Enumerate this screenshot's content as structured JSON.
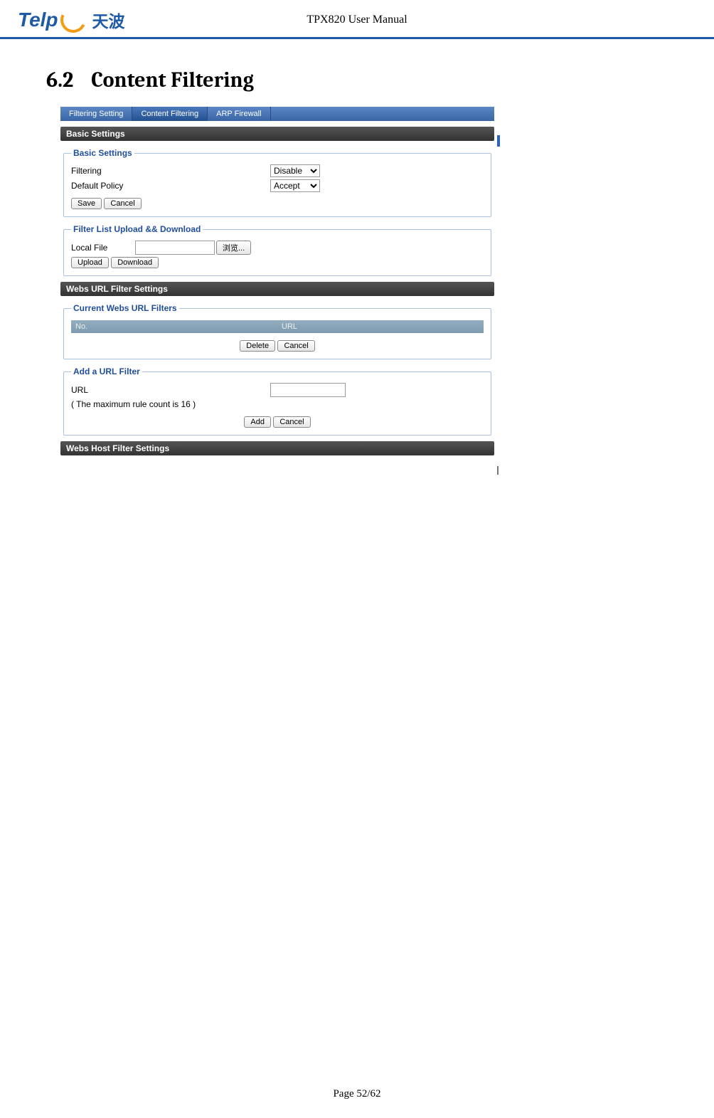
{
  "header": {
    "logo_brand_a": "Telp",
    "logo_brand_cn": "天波",
    "doc_title": "TPX820 User Manual"
  },
  "section": {
    "number": "6.2",
    "title": "Content Filtering"
  },
  "screenshot": {
    "tabs": [
      "Filtering Setting",
      "Content Filtering",
      "ARP Firewall"
    ],
    "bar_basic": "Basic Settings",
    "fs_basic": {
      "legend": "Basic Settings",
      "filtering_label": "Filtering",
      "filtering_value": "Disable",
      "default_policy_label": "Default Policy",
      "default_policy_value": "Accept",
      "save": "Save",
      "cancel": "Cancel"
    },
    "fs_upload": {
      "legend": "Filter List Upload && Download",
      "local_file_label": "Local File",
      "browse": "浏览...",
      "upload": "Upload",
      "download": "Download"
    },
    "bar_url": "Webs URL Filter Settings",
    "fs_current": {
      "legend": "Current Webs URL Filters",
      "col_no": "No.",
      "col_url": "URL",
      "delete": "Delete",
      "cancel": "Cancel"
    },
    "fs_add": {
      "legend": "Add a URL Filter",
      "url_label": "URL",
      "note": "( The maximum rule count is 16 )",
      "add": "Add",
      "cancel": "Cancel"
    },
    "bar_host": "Webs Host Filter Settings"
  },
  "footer": {
    "page": "Page 52/62"
  }
}
